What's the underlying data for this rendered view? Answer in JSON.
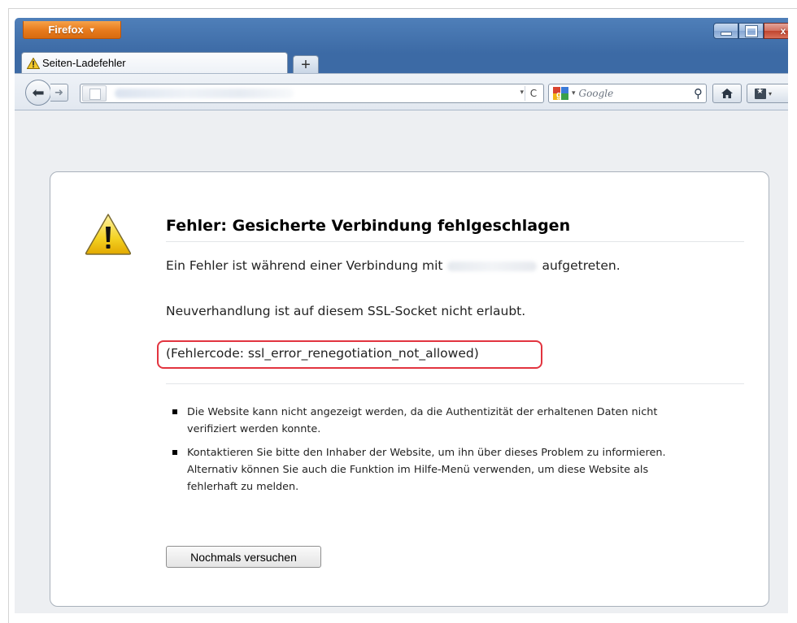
{
  "window": {
    "menu_button_label": "Firefox",
    "menu_button_caret": "▼",
    "close_label": "x"
  },
  "tab": {
    "title": "Seiten-Ladefehler",
    "new_tab_label": "+"
  },
  "navbar": {
    "back_glyph": "⬅",
    "forward_glyph": "➜",
    "reload_glyph": "C",
    "dropdown_glyph": "▾",
    "search_placeholder": "Google",
    "search_glyph": "⚲",
    "home_glyph": "⌂"
  },
  "error_page": {
    "title": "Fehler: Gesicherte Verbindung fehlgeschlagen",
    "line1_prefix": "Ein Fehler ist während einer Verbindung mit",
    "line1_suffix": "aufgetreten.",
    "line2": "Neuverhandlung ist auf diesem SSL-Socket nicht erlaubt.",
    "error_code": "(Fehlercode: ssl_error_renegotiation_not_allowed)",
    "bullets": [
      "Die Website kann nicht angezeigt werden, da die Authentizität der erhaltenen Daten nicht verifiziert werden konnte.",
      "Kontaktieren Sie bitte den Inhaber der Website, um ihn über dieses Problem zu informieren. Alternativ können Sie auch die Funktion im Hilfe-Menü verwenden, um diese Website als fehlerhaft zu melden."
    ],
    "retry_button": "Nochmals versuchen"
  },
  "colors": {
    "highlight": "#e2343f",
    "firefox_orange": "#e77a1c",
    "window_blue": "#3a67a0",
    "warning_yellow": "#f4d223"
  },
  "icons": {
    "tab_icon": "warning-icon",
    "error_icon": "warning-triangle-icon",
    "home": "home-icon",
    "bookmarks": "bookmarks-icon",
    "search": "search-icon"
  }
}
